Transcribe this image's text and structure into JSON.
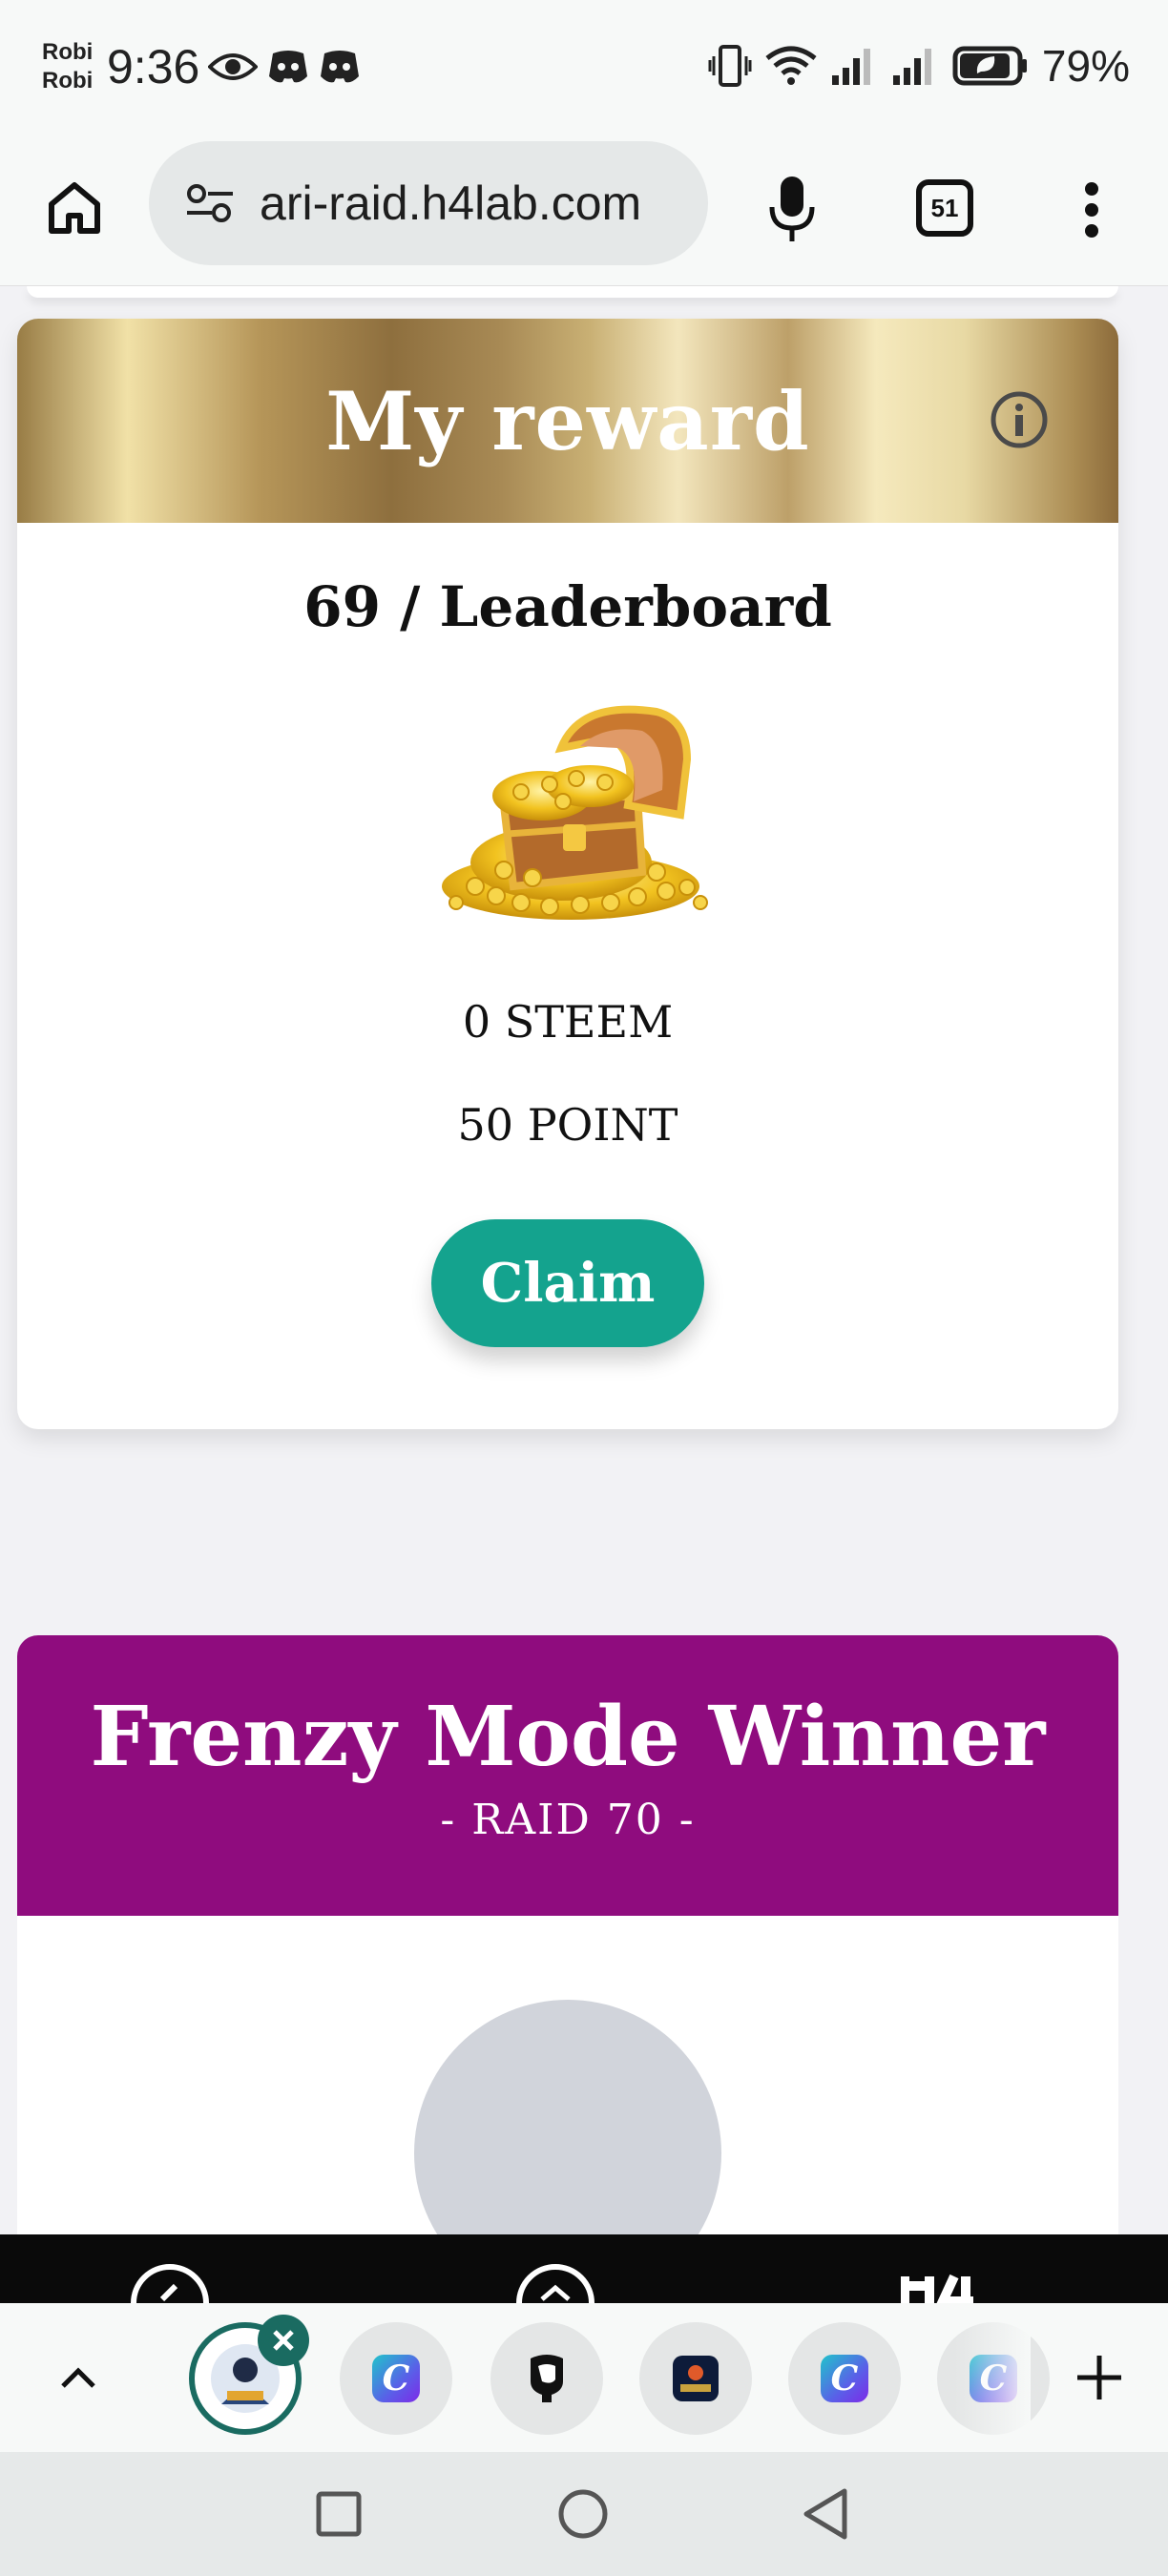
{
  "status_bar": {
    "carrier_line1": "Robi",
    "carrier_line2": "Robi",
    "time": "9:36",
    "battery": "79%",
    "icons": [
      "eye-icon",
      "discord-icon",
      "discord-icon",
      "vibrate-icon",
      "wifi-icon",
      "signal-icon",
      "signal-icon",
      "battery-saver-icon"
    ]
  },
  "browser": {
    "url": " ari-raid.h4lab.com",
    "tab_count": "51",
    "icons": [
      "home-icon",
      "site-settings-icon",
      "mic-icon",
      "tabs-icon",
      "more-vert-icon"
    ]
  },
  "reward_card": {
    "title": "My reward",
    "rank": "69 / Leaderboard",
    "steem_amount": "0",
    "steem_unit": "STEEM",
    "point_amount": "50",
    "point_unit": "POINT",
    "claim_label": "Claim",
    "header_color": "#8e6f3e",
    "claim_color": "#14a38e"
  },
  "frenzy_card": {
    "title": "Frenzy Mode Winner",
    "subtitle": "- RAID 70 -",
    "header_color": "#8f0c7e"
  },
  "tab_strip": {
    "tabs": [
      {
        "name": "h4lab-raid",
        "active": true
      },
      {
        "name": "canva"
      },
      {
        "name": "steemit"
      },
      {
        "name": "steem-app"
      },
      {
        "name": "canva"
      },
      {
        "name": "canva"
      }
    ]
  },
  "system_nav": {
    "icons": [
      "recents-icon",
      "home-icon",
      "back-icon"
    ]
  }
}
